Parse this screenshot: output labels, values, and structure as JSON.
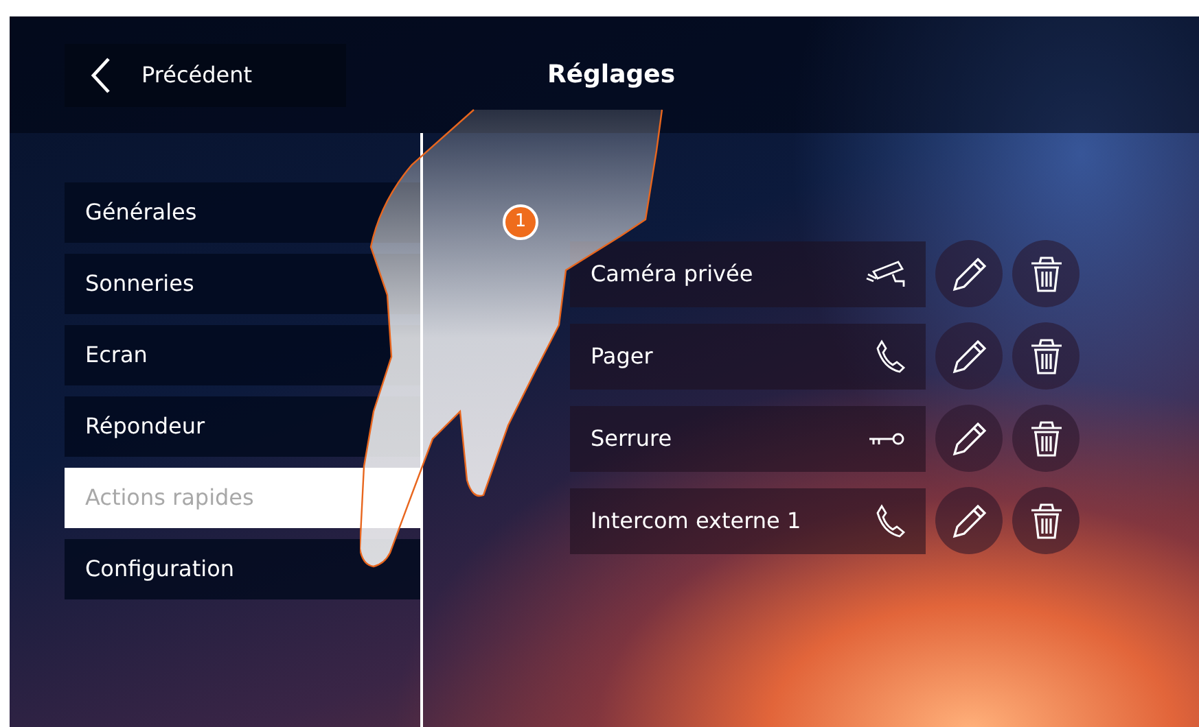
{
  "header": {
    "back_button": "Précédent",
    "title": "Réglages"
  },
  "menu": [
    {
      "label": "Générales",
      "selected": false
    },
    {
      "label": "Sonneries",
      "selected": false
    },
    {
      "label": "Ecran",
      "selected": false
    },
    {
      "label": "Répondeur",
      "selected": false
    },
    {
      "label": "Actions rapides",
      "selected": true
    },
    {
      "label": "Configuration",
      "selected": false
    }
  ],
  "actions": [
    {
      "label": "Caméra privée",
      "kind": "camera"
    },
    {
      "label": "Pager",
      "kind": "phone"
    },
    {
      "label": "Serrure",
      "kind": "key"
    },
    {
      "label": "Intercom externe 1",
      "kind": "phone"
    }
  ],
  "step_badge": "1"
}
